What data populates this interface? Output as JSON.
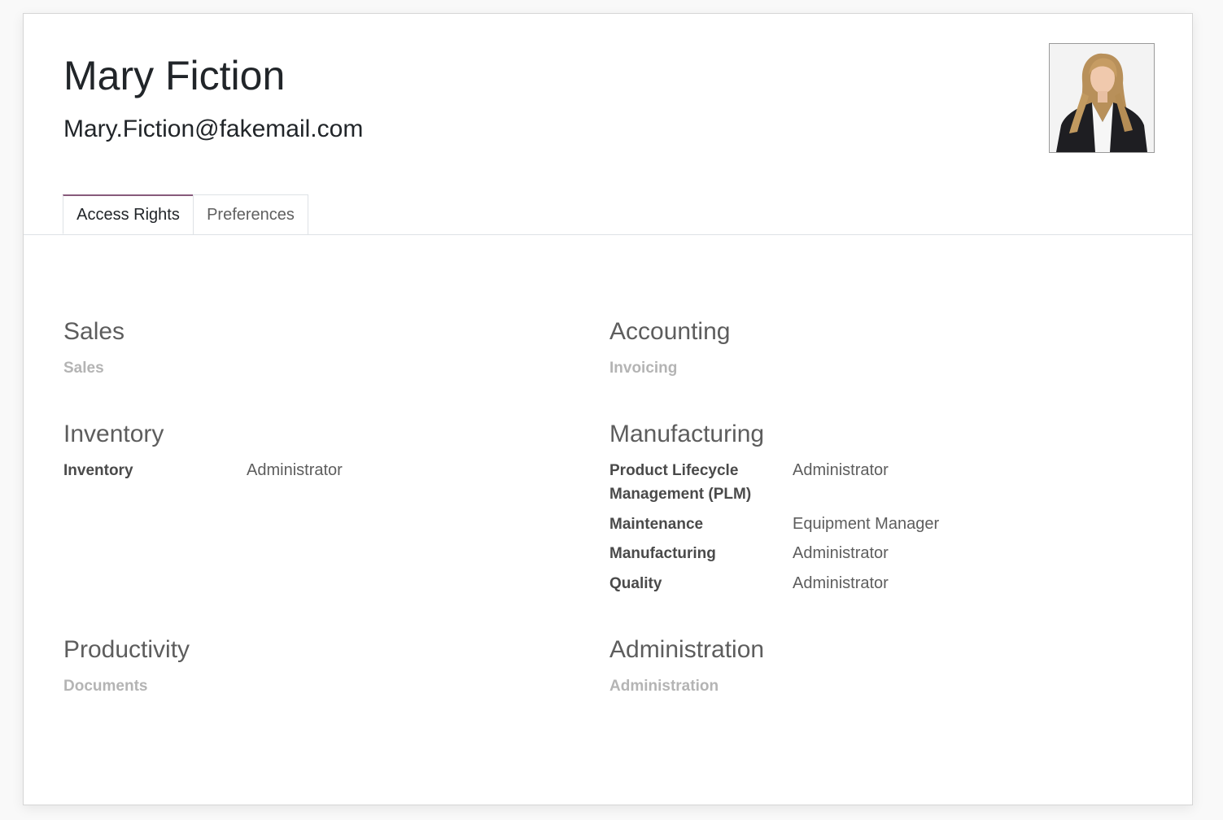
{
  "user": {
    "name": "Mary Fiction",
    "email": "Mary.Fiction@fakemail.com"
  },
  "tabs": [
    {
      "label": "Access Rights",
      "active": true
    },
    {
      "label": "Preferences",
      "active": false
    }
  ],
  "groups": {
    "sales": {
      "title": "Sales",
      "rows": [
        {
          "label": "Sales",
          "value": ""
        }
      ]
    },
    "accounting": {
      "title": "Accounting",
      "rows": [
        {
          "label": "Invoicing",
          "value": ""
        }
      ]
    },
    "inventory": {
      "title": "Inventory",
      "rows": [
        {
          "label": "Inventory",
          "value": "Administrator"
        }
      ]
    },
    "manufacturing": {
      "title": "Manufacturing",
      "rows": [
        {
          "label": "Product Lifecycle Management (PLM)",
          "value": "Administrator"
        },
        {
          "label": "Maintenance",
          "value": "Equipment Manager"
        },
        {
          "label": "Manufacturing",
          "value": "Administrator"
        },
        {
          "label": "Quality",
          "value": "Administrator"
        }
      ]
    },
    "productivity": {
      "title": "Productivity",
      "rows": [
        {
          "label": "Documents",
          "value": ""
        }
      ]
    },
    "administration": {
      "title": "Administration",
      "rows": [
        {
          "label": "Administration",
          "value": ""
        }
      ]
    }
  },
  "colors": {
    "tab_accent": "#875a7b",
    "heading": "#5d5d5d",
    "muted_label": "#b4b4b4"
  }
}
